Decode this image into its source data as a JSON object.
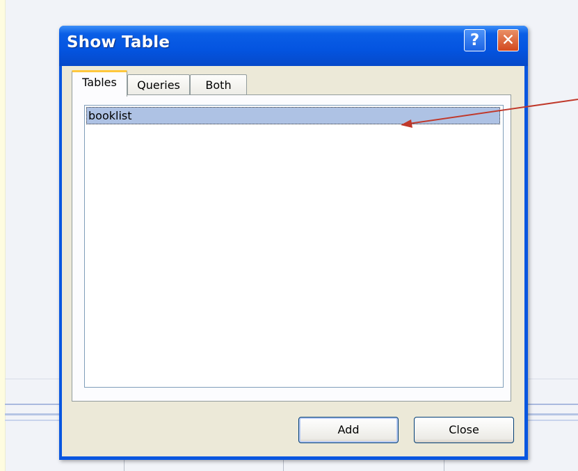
{
  "dialog": {
    "title": "Show Table",
    "help_button": "?",
    "close_button": "✕",
    "tabs": [
      {
        "label": "Tables",
        "selected": true
      },
      {
        "label": "Queries",
        "selected": false
      },
      {
        "label": "Both",
        "selected": false
      }
    ],
    "list_items": [
      {
        "label": "booklist",
        "selected": true
      }
    ],
    "buttons": {
      "add": "Add",
      "close": "Close"
    }
  },
  "colors": {
    "titlebar": "#0454e0",
    "selection": "#aec2e4",
    "annotation_arrow": "#c0392b"
  }
}
